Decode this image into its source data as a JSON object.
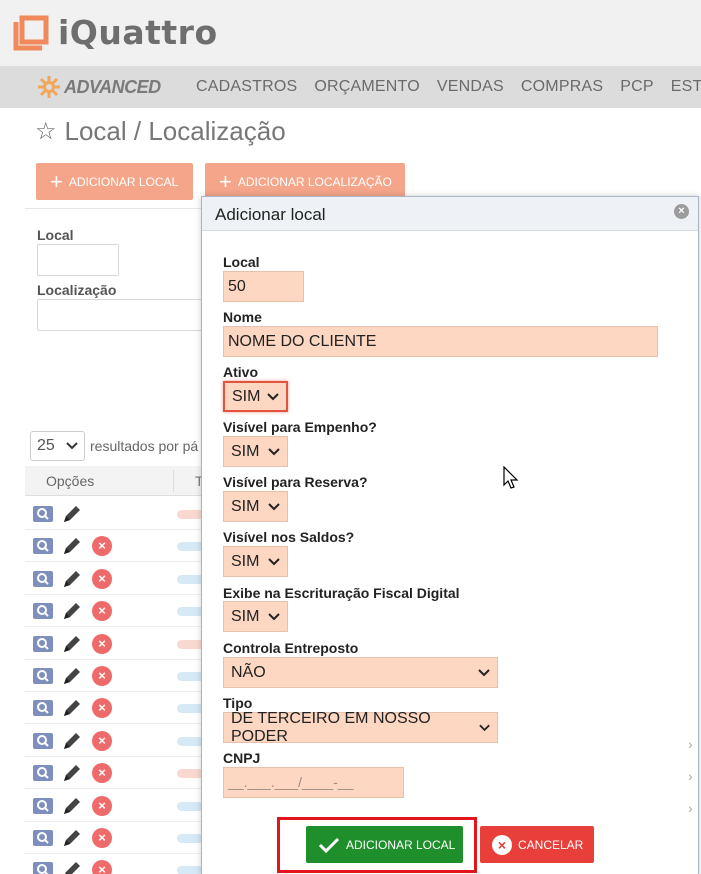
{
  "header": {
    "app_name": "iQuattro"
  },
  "navbar": {
    "brand": "ADVANCED",
    "items": [
      "CADASTROS",
      "ORÇAMENTO",
      "VENDAS",
      "COMPRAS",
      "PCP",
      "ESTOQ"
    ]
  },
  "page": {
    "title": "Local / Localização",
    "buttons": {
      "add_local": "ADICIONAR LOCAL",
      "add_localizacao": "ADICIONAR LOCALIZAÇÃO"
    },
    "filters": {
      "local_label": "Local",
      "localizacao_label": "Localização"
    },
    "pagination": {
      "per_page": "25",
      "per_page_text": "resultados por pá"
    },
    "grid": {
      "options_header": "Opções",
      "second_header": "T"
    }
  },
  "dialog": {
    "title": "Adicionar local",
    "fields": {
      "local": {
        "label": "Local",
        "value": "50"
      },
      "nome": {
        "label": "Nome",
        "value": "NOME DO CLIENTE"
      },
      "ativo": {
        "label": "Ativo",
        "value": "SIM"
      },
      "empenho": {
        "label": "Visível para Empenho?",
        "value": "SIM"
      },
      "reserva": {
        "label": "Visível para Reserva?",
        "value": "SIM"
      },
      "saldos": {
        "label": "Visível nos Saldos?",
        "value": "SIM"
      },
      "escrituracao": {
        "label": "Exibe na Escrituração Fiscal Digital",
        "value": "SIM"
      },
      "entreposto": {
        "label": "Controla Entreposto",
        "value": "NÃO"
      },
      "tipo": {
        "label": "Tipo",
        "value": "DE TERCEIRO EM NOSSO PODER"
      },
      "cnpj": {
        "label": "CNPJ",
        "placeholder": "__.___.___/____-__"
      }
    },
    "buttons": {
      "add": "ADICIONAR LOCAL",
      "cancel": "CANCELAR"
    }
  },
  "colors": {
    "accent": "#f4a58a",
    "field_bg": "#fdd7c2",
    "success": "#1f8f2c",
    "danger": "#e83f3a",
    "highlight": "#e1151b"
  }
}
